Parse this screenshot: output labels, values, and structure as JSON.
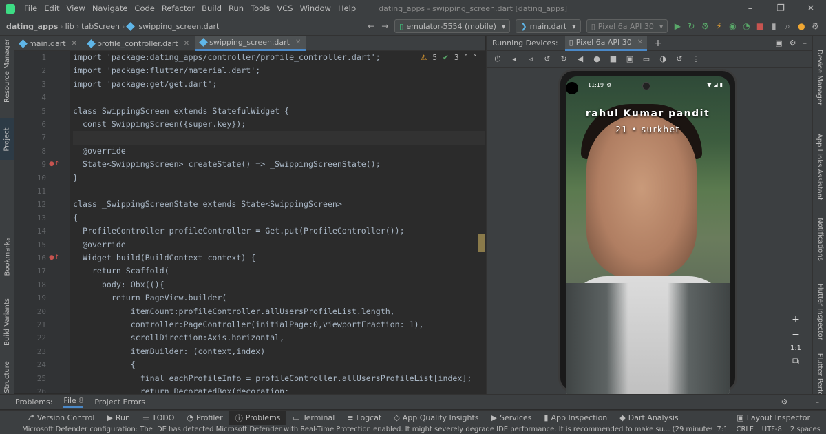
{
  "menu": [
    "File",
    "Edit",
    "View",
    "Navigate",
    "Code",
    "Refactor",
    "Build",
    "Run",
    "Tools",
    "VCS",
    "Window",
    "Help"
  ],
  "window_title": "dating_apps - swipping_screen.dart [dating_apps]",
  "breadcrumb": [
    "dating_apps",
    "lib",
    "tabScreen",
    "swipping_screen.dart"
  ],
  "toolbar": {
    "device": "emulator-5554 (mobile)",
    "run_config": "main.dart",
    "avd": "Pixel 6a API 30"
  },
  "tabs": [
    "main.dart",
    "profile_controller.dart",
    "swipping_screen.dart"
  ],
  "warnings": {
    "warn": "5",
    "ok": "3"
  },
  "line_numbers": [
    "1",
    "2",
    "3",
    "4",
    "5",
    "6",
    "7",
    "8",
    "9",
    "10",
    "11",
    "12",
    "13",
    "14",
    "15",
    "16",
    "17",
    "18",
    "19",
    "20",
    "21",
    "22",
    "23",
    "24",
    "25",
    "26"
  ],
  "code": [
    "import 'package:dating_apps/controller/profile_controller.dart';",
    "import 'package:flutter/material.dart';",
    "import 'package:get/get.dart';",
    "",
    "class SwippingScreen extends StatefulWidget {",
    "  const SwippingScreen({super.key});",
    "",
    "  @override",
    "  State<SwippingScreen> createState() => _SwippingScreenState();",
    "}",
    "",
    "class _SwippingScreenState extends State<SwippingScreen>",
    "{",
    "  ProfileController profileController = Get.put(ProfileController());",
    "  @override",
    "  Widget build(BuildContext context) {",
    "    return Scaffold(",
    "      body: Obx((){",
    "        return PageView.builder(",
    "            itemCount:profileController.allUsersProfileList.length,",
    "            controller:PageController(initialPage:0,viewportFraction: 1),",
    "            scrollDirection:Axis.horizontal,",
    "            itemBuilder: (context,index)",
    "            {",
    "              final eachProfileInfo = profileController.allUsersProfileList[index];",
    "              return DecoratedBox(decoration:"
  ],
  "running": {
    "label": "Running Devices:",
    "device_tab": "Pixel 6a API 30"
  },
  "phone": {
    "time": "11:19",
    "name": "rahul Kumar pandit",
    "info": "21 • surkhet"
  },
  "zoom": [
    "+",
    "−",
    "1:1",
    "⧉"
  ],
  "left_tabs": [
    "Resource Manager",
    "Project",
    "Bookmarks",
    "Build Variants",
    "Structure"
  ],
  "right_tabs": [
    "Device Manager",
    "App Links Assistant",
    "Notifications",
    "Flutter Inspector",
    "Flutter Performance"
  ],
  "problems": {
    "label": "Problems:",
    "file": "File",
    "file_count": "8",
    "project": "Project Errors"
  },
  "toolwindows": [
    "Version Control",
    "Run",
    "TODO",
    "Profiler",
    "Problems",
    "Terminal",
    "Logcat",
    "App Quality Insights",
    "Services",
    "App Inspection",
    "Dart Analysis"
  ],
  "layout_inspector": "Layout Inspector",
  "status": {
    "message": "Microsoft Defender configuration: The IDE has detected Microsoft Defender with Real-Time Protection enabled. It might severely degrade IDE performance. It is recommended to make su... (29 minutes ago)",
    "pos": "7:1",
    "eol": "CRLF",
    "enc": "UTF-8",
    "indent": "2 spaces"
  }
}
